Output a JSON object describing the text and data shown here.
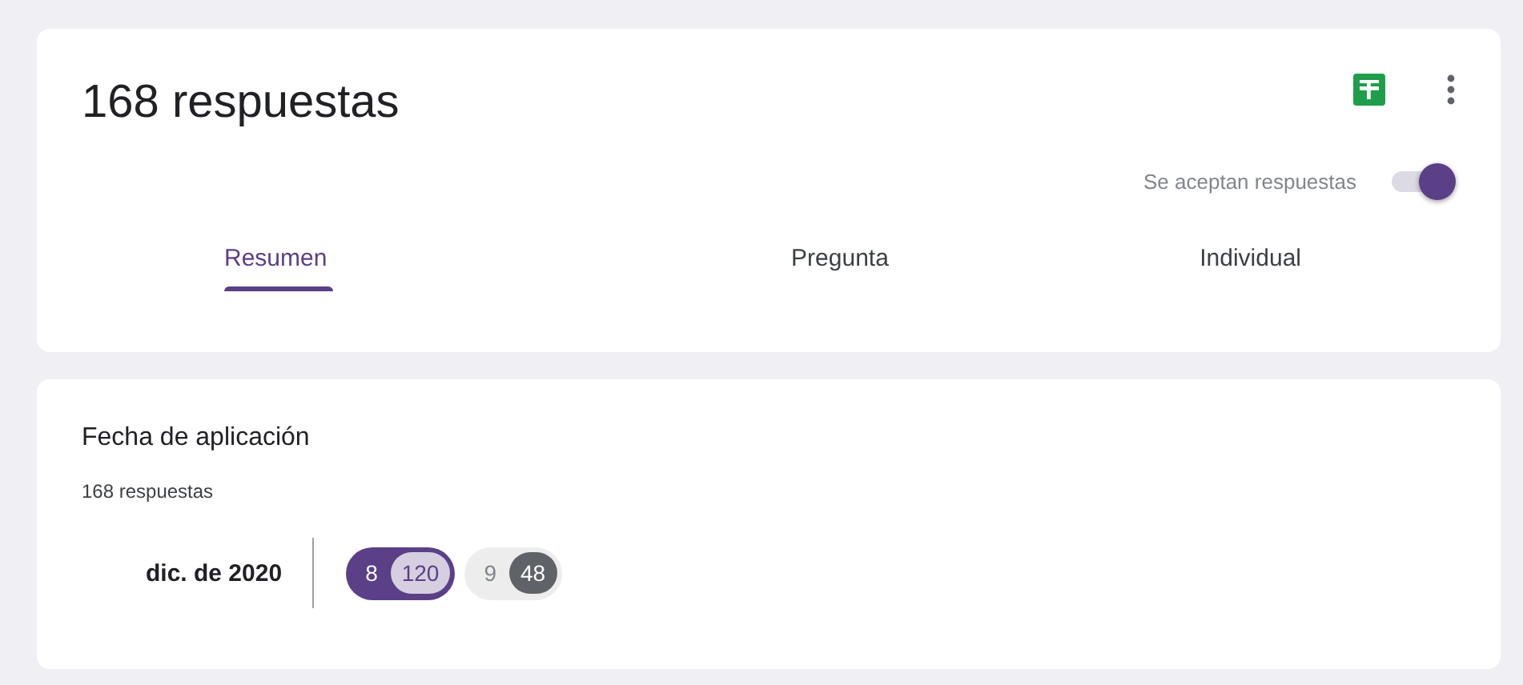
{
  "header": {
    "title": "168 respuestas",
    "accepting": {
      "label": "Se aceptan respuestas",
      "on": true
    }
  },
  "tabs": [
    {
      "label": "Resumen",
      "selected": true
    },
    {
      "label": "Pregunta",
      "selected": false
    },
    {
      "label": "Individual",
      "selected": false
    }
  ],
  "question": {
    "title": "Fecha de aplicación",
    "count": "168 respuestas",
    "months": [
      {
        "label": "dic. de 2020",
        "days": [
          {
            "day": "8",
            "count": "120",
            "selected": true
          },
          {
            "day": "9",
            "count": "48",
            "selected": false
          }
        ]
      }
    ]
  }
}
